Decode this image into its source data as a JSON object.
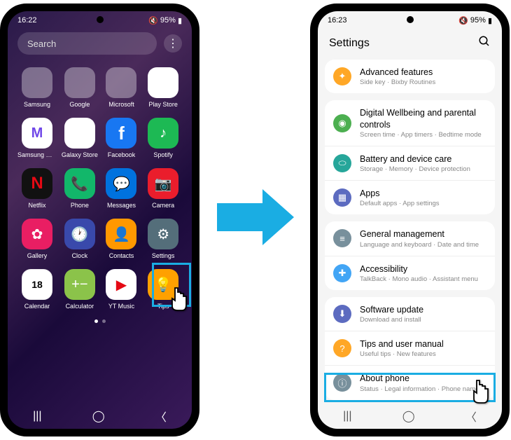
{
  "left": {
    "time": "16:22",
    "battery": "95%",
    "search_placeholder": "Search",
    "apps": [
      {
        "label": "Samsung",
        "type": "folder",
        "minis": [
          "#eee",
          "#c2185b",
          "#ffb300",
          "#1976d2"
        ]
      },
      {
        "label": "Google",
        "type": "folder",
        "minis": [
          "#fff",
          "#ea4335",
          "#4285f4",
          "#34a853"
        ]
      },
      {
        "label": "Microsoft",
        "type": "folder",
        "minis": [
          "#2b579a",
          "#217346",
          "#0078d4",
          "#d83b01"
        ]
      },
      {
        "label": "Play Store",
        "cls": "ic-ps",
        "glyph": "▶"
      },
      {
        "label": "Samsung Members",
        "cls": "ic-m",
        "glyph": "M"
      },
      {
        "label": "Galaxy Store",
        "cls": "ic-gs",
        "glyph": "🛍"
      },
      {
        "label": "Facebook",
        "cls": "ic-fb",
        "glyph": "f"
      },
      {
        "label": "Spotify",
        "cls": "ic-sp",
        "glyph": "♪"
      },
      {
        "label": "Netflix",
        "cls": "ic-nf",
        "glyph": "N"
      },
      {
        "label": "Phone",
        "cls": "ic-ph",
        "glyph": "📞"
      },
      {
        "label": "Messages",
        "cls": "ic-msg",
        "glyph": "💬"
      },
      {
        "label": "Camera",
        "cls": "ic-cam",
        "glyph": "📷"
      },
      {
        "label": "Gallery",
        "cls": "ic-gal",
        "glyph": "✿"
      },
      {
        "label": "Clock",
        "cls": "ic-clk",
        "glyph": "🕐"
      },
      {
        "label": "Contacts",
        "cls": "ic-con",
        "glyph": "👤"
      },
      {
        "label": "Settings",
        "cls": "ic-set",
        "glyph": "⚙"
      },
      {
        "label": "Calendar",
        "cls": "ic-cal",
        "glyph": "18"
      },
      {
        "label": "Calculator",
        "cls": "ic-calc",
        "glyph": "+−"
      },
      {
        "label": "YT Music",
        "cls": "ic-yt",
        "glyph": "▶"
      },
      {
        "label": "Tips",
        "cls": "ic-tip",
        "glyph": "💡"
      }
    ]
  },
  "right": {
    "time": "16:23",
    "battery": "95%",
    "title": "Settings",
    "groups": [
      [
        {
          "title": "Advanced features",
          "sub": "Side key · Bixby Routines",
          "color": "#ffa726",
          "glyph": "✦"
        }
      ],
      [
        {
          "title": "Digital Wellbeing and parental controls",
          "sub": "Screen time · App timers · Bedtime mode",
          "color": "#4caf50",
          "glyph": "◉"
        },
        {
          "title": "Battery and device care",
          "sub": "Storage · Memory · Device protection",
          "color": "#26a69a",
          "glyph": "⬭"
        },
        {
          "title": "Apps",
          "sub": "Default apps · App settings",
          "color": "#5c6bc0",
          "glyph": "▦"
        }
      ],
      [
        {
          "title": "General management",
          "sub": "Language and keyboard · Date and time",
          "color": "#78909c",
          "glyph": "≡"
        },
        {
          "title": "Accessibility",
          "sub": "TalkBack · Mono audio · Assistant menu",
          "color": "#42a5f5",
          "glyph": "✚"
        }
      ],
      [
        {
          "title": "Software update",
          "sub": "Download and install",
          "color": "#5c6bc0",
          "glyph": "⬇"
        },
        {
          "title": "Tips and user manual",
          "sub": "Useful tips · New features",
          "color": "#ffa726",
          "glyph": "?"
        },
        {
          "title": "About phone",
          "sub": "Status · Legal information · Phone name",
          "color": "#78909c",
          "glyph": "ⓘ"
        }
      ]
    ]
  }
}
